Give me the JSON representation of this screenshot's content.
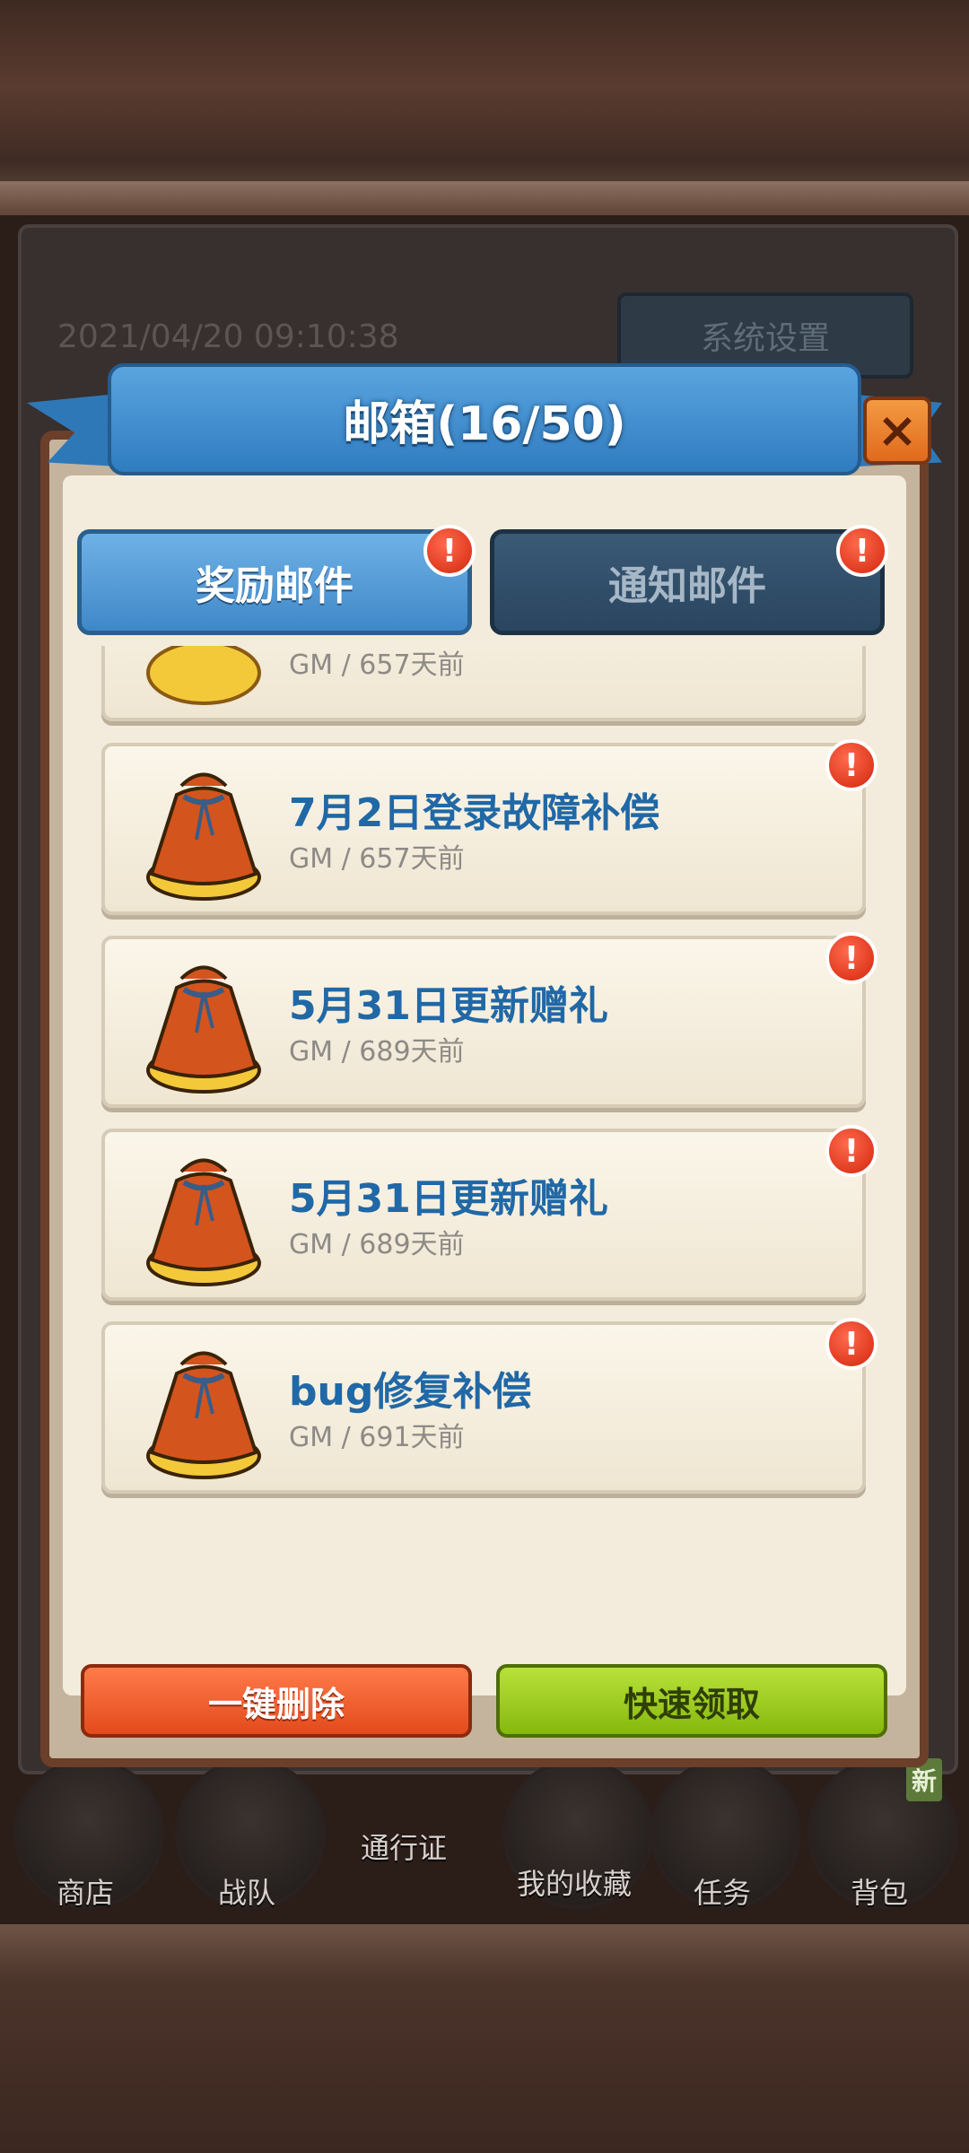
{
  "background": {
    "date": "2021/04/20 09:10:38",
    "settings_label": "系统设置"
  },
  "nav": {
    "shop": "商店",
    "team": "战队",
    "pass": "通行证",
    "collection": "我的收藏",
    "tasks": "任务",
    "bag": "背包",
    "new_badge": "新"
  },
  "dialog": {
    "title": "邮箱(16/50)",
    "close_icon": "×",
    "tabs": [
      {
        "label": "奖励邮件",
        "active": true
      },
      {
        "label": "通知邮件",
        "active": false
      }
    ],
    "alert_glyph": "!"
  },
  "mails": [
    {
      "title": "",
      "meta": "GM / 657天前",
      "unread": false,
      "partial": true
    },
    {
      "title": "7月2日登录故障补偿",
      "meta": "GM / 657天前",
      "unread": true
    },
    {
      "title": "5月31日更新赠礼",
      "meta": "GM / 689天前",
      "unread": true
    },
    {
      "title": "5月31日更新赠礼",
      "meta": "GM / 689天前",
      "unread": true
    },
    {
      "title": "bug修复补偿",
      "meta": "GM / 691天前",
      "unread": true
    }
  ],
  "actions": {
    "delete_all": "一键删除",
    "quick_claim": "快速领取"
  },
  "colors": {
    "title_blue": "#2068a6",
    "delete_red": "#e34a1c",
    "claim_green": "#86b80c"
  }
}
